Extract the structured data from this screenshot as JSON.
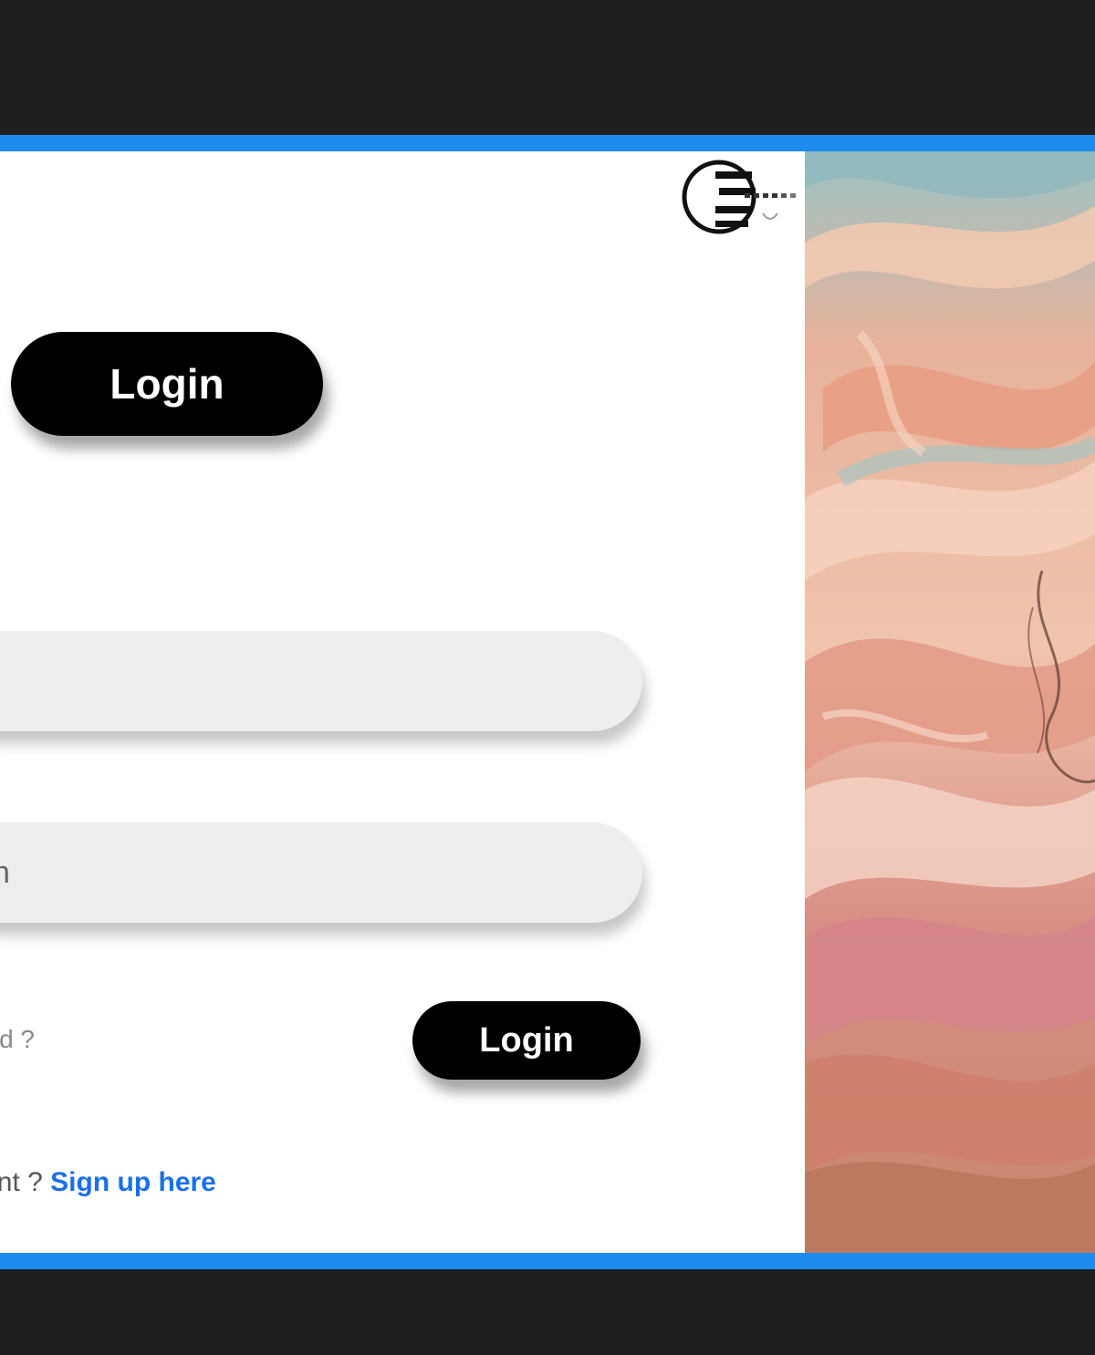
{
  "colors": {
    "outer_background": "#1f1f1f",
    "frame_border": "#1e8bef",
    "button_bg": "#000000",
    "button_text": "#ffffff",
    "field_bg": "#eeeeee",
    "link": "#1a6fe8"
  },
  "header": {
    "logo_icon": "brand-logo-icon"
  },
  "tabs": {
    "login_label": "Login"
  },
  "form": {
    "username_placeholder": "",
    "password_placeholder": "",
    "password_visible_fragment": "n",
    "forgot_text": "d ?",
    "submit_label": "Login"
  },
  "footer": {
    "signup_prompt": "e an account ?",
    "signup_link": "Sign up here"
  },
  "artwork": {
    "icon": "swirling-pink-clouds-illustration",
    "palette": [
      "#e9a58a",
      "#f2c1a8",
      "#8fbcc0",
      "#d98a7a",
      "#c46d5a",
      "#f5d6c4"
    ]
  }
}
